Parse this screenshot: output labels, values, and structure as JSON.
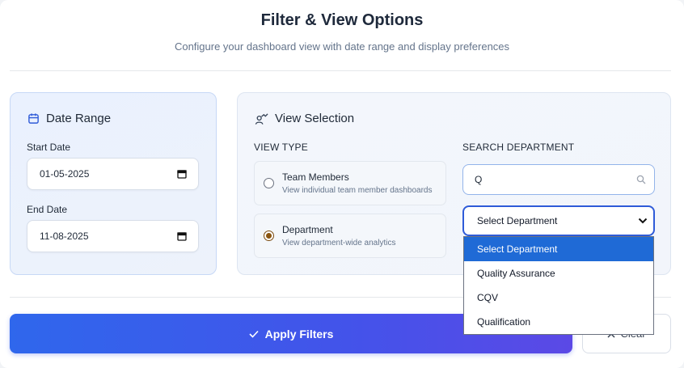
{
  "header": {
    "title": "Filter & View Options",
    "subtitle": "Configure your dashboard view with date range and display preferences"
  },
  "date_range": {
    "heading": "Date Range",
    "icon": "calendar-icon",
    "start_label": "Start Date",
    "start_value": "01-05-2025",
    "end_label": "End Date",
    "end_value": "11-08-2025"
  },
  "view_selection": {
    "heading": "View Selection",
    "icon": "user-chart-icon",
    "view_type_label": "VIEW TYPE",
    "options": [
      {
        "title": "Team Members",
        "description": "View individual team member dashboards",
        "checked": false
      },
      {
        "title": "Department",
        "description": "View department-wide analytics",
        "checked": true
      }
    ],
    "search_label": "SEARCH DEPARTMENT",
    "search_value": "Q",
    "select_value": "Select Department",
    "dropdown_options": [
      "Select Department",
      "Quality Assurance",
      "CQV",
      "Qualification"
    ]
  },
  "actions": {
    "apply_label": "Apply Filters",
    "clear_label": "Clear"
  },
  "colors": {
    "accent": "#2f5bd8",
    "apply_gradient_start": "#2f67ec",
    "apply_gradient_end": "#5b49e6",
    "radio_checked": "#8a5510",
    "dropdown_highlight": "#1f6ad6"
  }
}
